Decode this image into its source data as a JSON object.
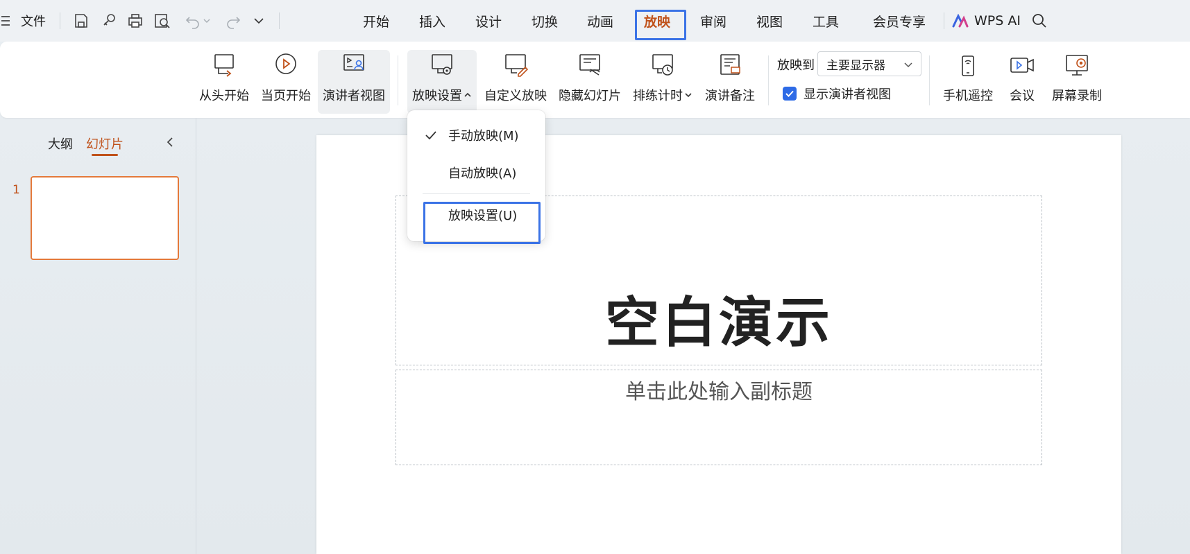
{
  "menubar": {
    "file_label": "文件",
    "quick_access": [
      "save-icon",
      "link-icon",
      "print-icon",
      "print-preview-icon",
      "undo-icon",
      "undo-dropdown-icon",
      "redo-icon",
      "more-icon"
    ],
    "tabs": [
      {
        "label": "开始",
        "active": false
      },
      {
        "label": "插入",
        "active": false
      },
      {
        "label": "设计",
        "active": false
      },
      {
        "label": "切换",
        "active": false
      },
      {
        "label": "动画",
        "active": false
      },
      {
        "label": "放映",
        "active": true
      },
      {
        "label": "审阅",
        "active": false
      },
      {
        "label": "视图",
        "active": false
      },
      {
        "label": "工具",
        "active": false
      },
      {
        "label": "会员专享",
        "active": false
      }
    ],
    "wps_ai_label": "WPS AI",
    "accent_color": "#c0521b",
    "highlight_color": "#3b73e6"
  },
  "ribbon": {
    "from_start": "从头开始",
    "from_current": "当页开始",
    "presenter_view": "演讲者视图",
    "show_settings": "放映设置",
    "custom_show": "自定义放映",
    "hide_slide": "隐藏幻灯片",
    "rehearse_timing": "排练计时",
    "speaker_notes": "演讲备注",
    "project_to_label": "放映到",
    "project_to_value": "主要显示器",
    "show_presenter_view_checkbox": "显示演讲者视图",
    "show_presenter_view_checked": true,
    "phone_remote": "手机遥控",
    "meeting": "会议",
    "screen_record": "屏幕录制"
  },
  "dropdown": {
    "items": [
      {
        "label": "手动放映(M)",
        "checked": true
      },
      {
        "label": "自动放映(A)",
        "checked": false
      },
      {
        "label": "放映设置(U)",
        "checked": false
      }
    ]
  },
  "left_panel": {
    "outline_tab": "大纲",
    "slides_tab": "幻灯片",
    "slide_number": "1"
  },
  "slide": {
    "title": "空白演示",
    "subtitle_placeholder": "单击此处输入副标题"
  }
}
